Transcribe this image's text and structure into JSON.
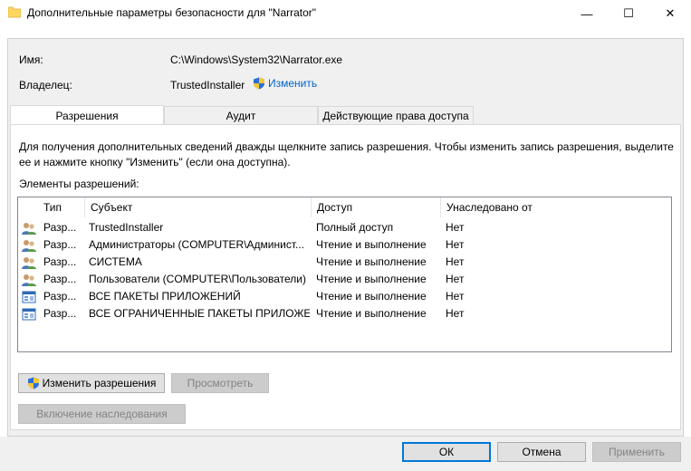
{
  "window": {
    "title": "Дополнительные параметры безопасности  для \"Narrator\"",
    "minimize_glyph": "—",
    "maximize_glyph": "☐",
    "close_glyph": "✕",
    "folder_color": "#ffd75e"
  },
  "fields": {
    "name_label": "Имя:",
    "name_value": "C:\\Windows\\System32\\Narrator.exe",
    "owner_label": "Владелец:",
    "owner_value": "TrustedInstaller",
    "change_link": "Изменить"
  },
  "tabs": [
    {
      "label": "Разрешения",
      "active": true
    },
    {
      "label": "Аудит",
      "active": false
    },
    {
      "label": "Действующие права доступа",
      "active": false
    }
  ],
  "permissions": {
    "instructions": "Для получения дополнительных сведений дважды щелкните запись разрешения. Чтобы изменить запись разрешения, выделите ее и нажмите кнопку \"Изменить\" (если она доступна).",
    "list_label": "Элементы разрешений:",
    "columns": [
      "Тип",
      "Субъект",
      "Доступ",
      "Унаследовано от"
    ],
    "rows": [
      {
        "icon": "users-icon",
        "type": "Разр...",
        "subject": "TrustedInstaller",
        "access": "Полный доступ",
        "inherited": "Нет"
      },
      {
        "icon": "users-icon",
        "type": "Разр...",
        "subject": "Администраторы (COMPUTER\\Админист...",
        "access": "Чтение и выполнение",
        "inherited": "Нет"
      },
      {
        "icon": "users-icon",
        "type": "Разр...",
        "subject": "СИСТЕМА",
        "access": "Чтение и выполнение",
        "inherited": "Нет"
      },
      {
        "icon": "users-icon",
        "type": "Разр...",
        "subject": "Пользователи (COMPUTER\\Пользователи)",
        "access": "Чтение и выполнение",
        "inherited": "Нет"
      },
      {
        "icon": "app-package-icon",
        "type": "Разр...",
        "subject": "ВСЕ ПАКЕТЫ ПРИЛОЖЕНИЙ",
        "access": "Чтение и выполнение",
        "inherited": "Нет"
      },
      {
        "icon": "app-package-icon",
        "type": "Разр...",
        "subject": "ВСЕ ОГРАНИЧЕННЫЕ ПАКЕТЫ ПРИЛОЖЕ...",
        "access": "Чтение и выполнение",
        "inherited": "Нет"
      }
    ],
    "change_permissions_button": "Изменить разрешения",
    "view_button": "Просмотреть",
    "enable_inheritance_button": "Включение наследования"
  },
  "footer": {
    "ok": "ОК",
    "cancel": "Отмена",
    "apply": "Применить"
  }
}
